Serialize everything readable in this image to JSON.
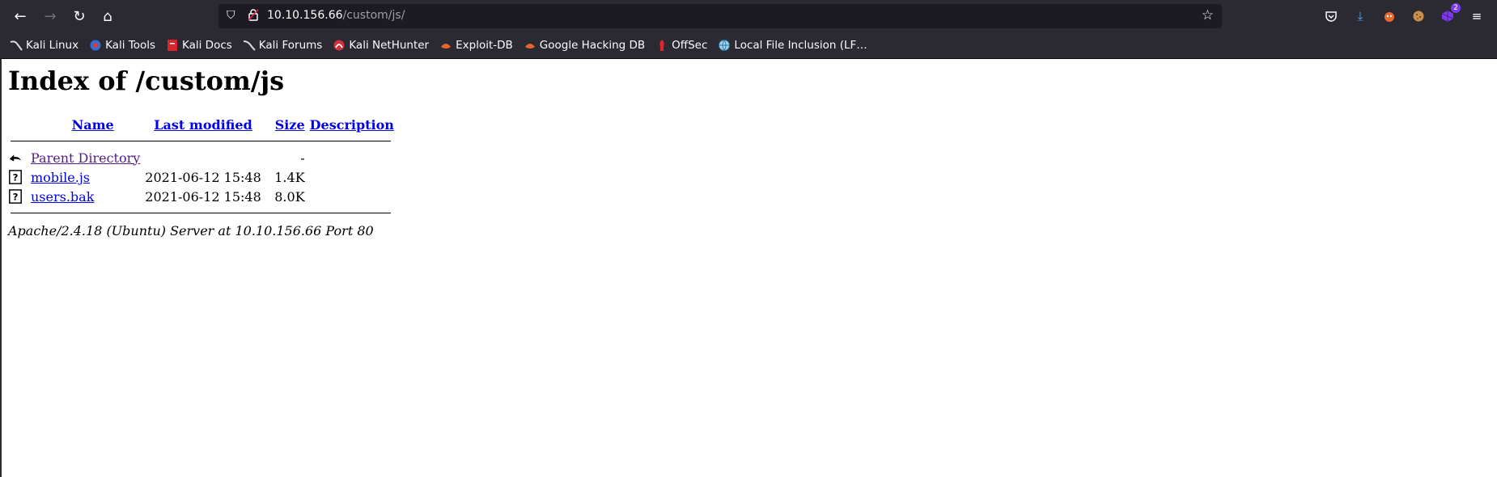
{
  "browser": {
    "url_host": "10.10.156.66",
    "url_path": "/custom/js/",
    "extension_badge": "2",
    "bookmarks": [
      {
        "label": "Kali Linux",
        "icon": "kali-dragon-icon"
      },
      {
        "label": "Kali Tools",
        "icon": "kali-tools-icon"
      },
      {
        "label": "Kali Docs",
        "icon": "kali-docs-icon"
      },
      {
        "label": "Kali Forums",
        "icon": "kali-forums-icon"
      },
      {
        "label": "Kali NetHunter",
        "icon": "nethunter-icon"
      },
      {
        "label": "Exploit-DB",
        "icon": "exploit-db-icon"
      },
      {
        "label": "Google Hacking DB",
        "icon": "ghdb-icon"
      },
      {
        "label": "OffSec",
        "icon": "offsec-icon"
      },
      {
        "label": "Local File Inclusion (LF…",
        "icon": "globe-icon"
      }
    ]
  },
  "page": {
    "title": "Index of /custom/js",
    "columns": {
      "name": "Name",
      "last_modified": "Last modified",
      "size": "Size",
      "description": "Description"
    },
    "rows": [
      {
        "name": "Parent Directory",
        "modified": "",
        "size": "-",
        "description": "",
        "icon": "back-arrow-icon"
      },
      {
        "name": "mobile.js",
        "modified": "2021-06-12 15:48",
        "size": "1.4K",
        "description": "",
        "icon": "unknown-file-icon"
      },
      {
        "name": "users.bak",
        "modified": "2021-06-12 15:48",
        "size": "8.0K",
        "description": "",
        "icon": "unknown-file-icon"
      }
    ],
    "footer": "Apache/2.4.18 (Ubuntu) Server at 10.10.156.66 Port 80"
  }
}
